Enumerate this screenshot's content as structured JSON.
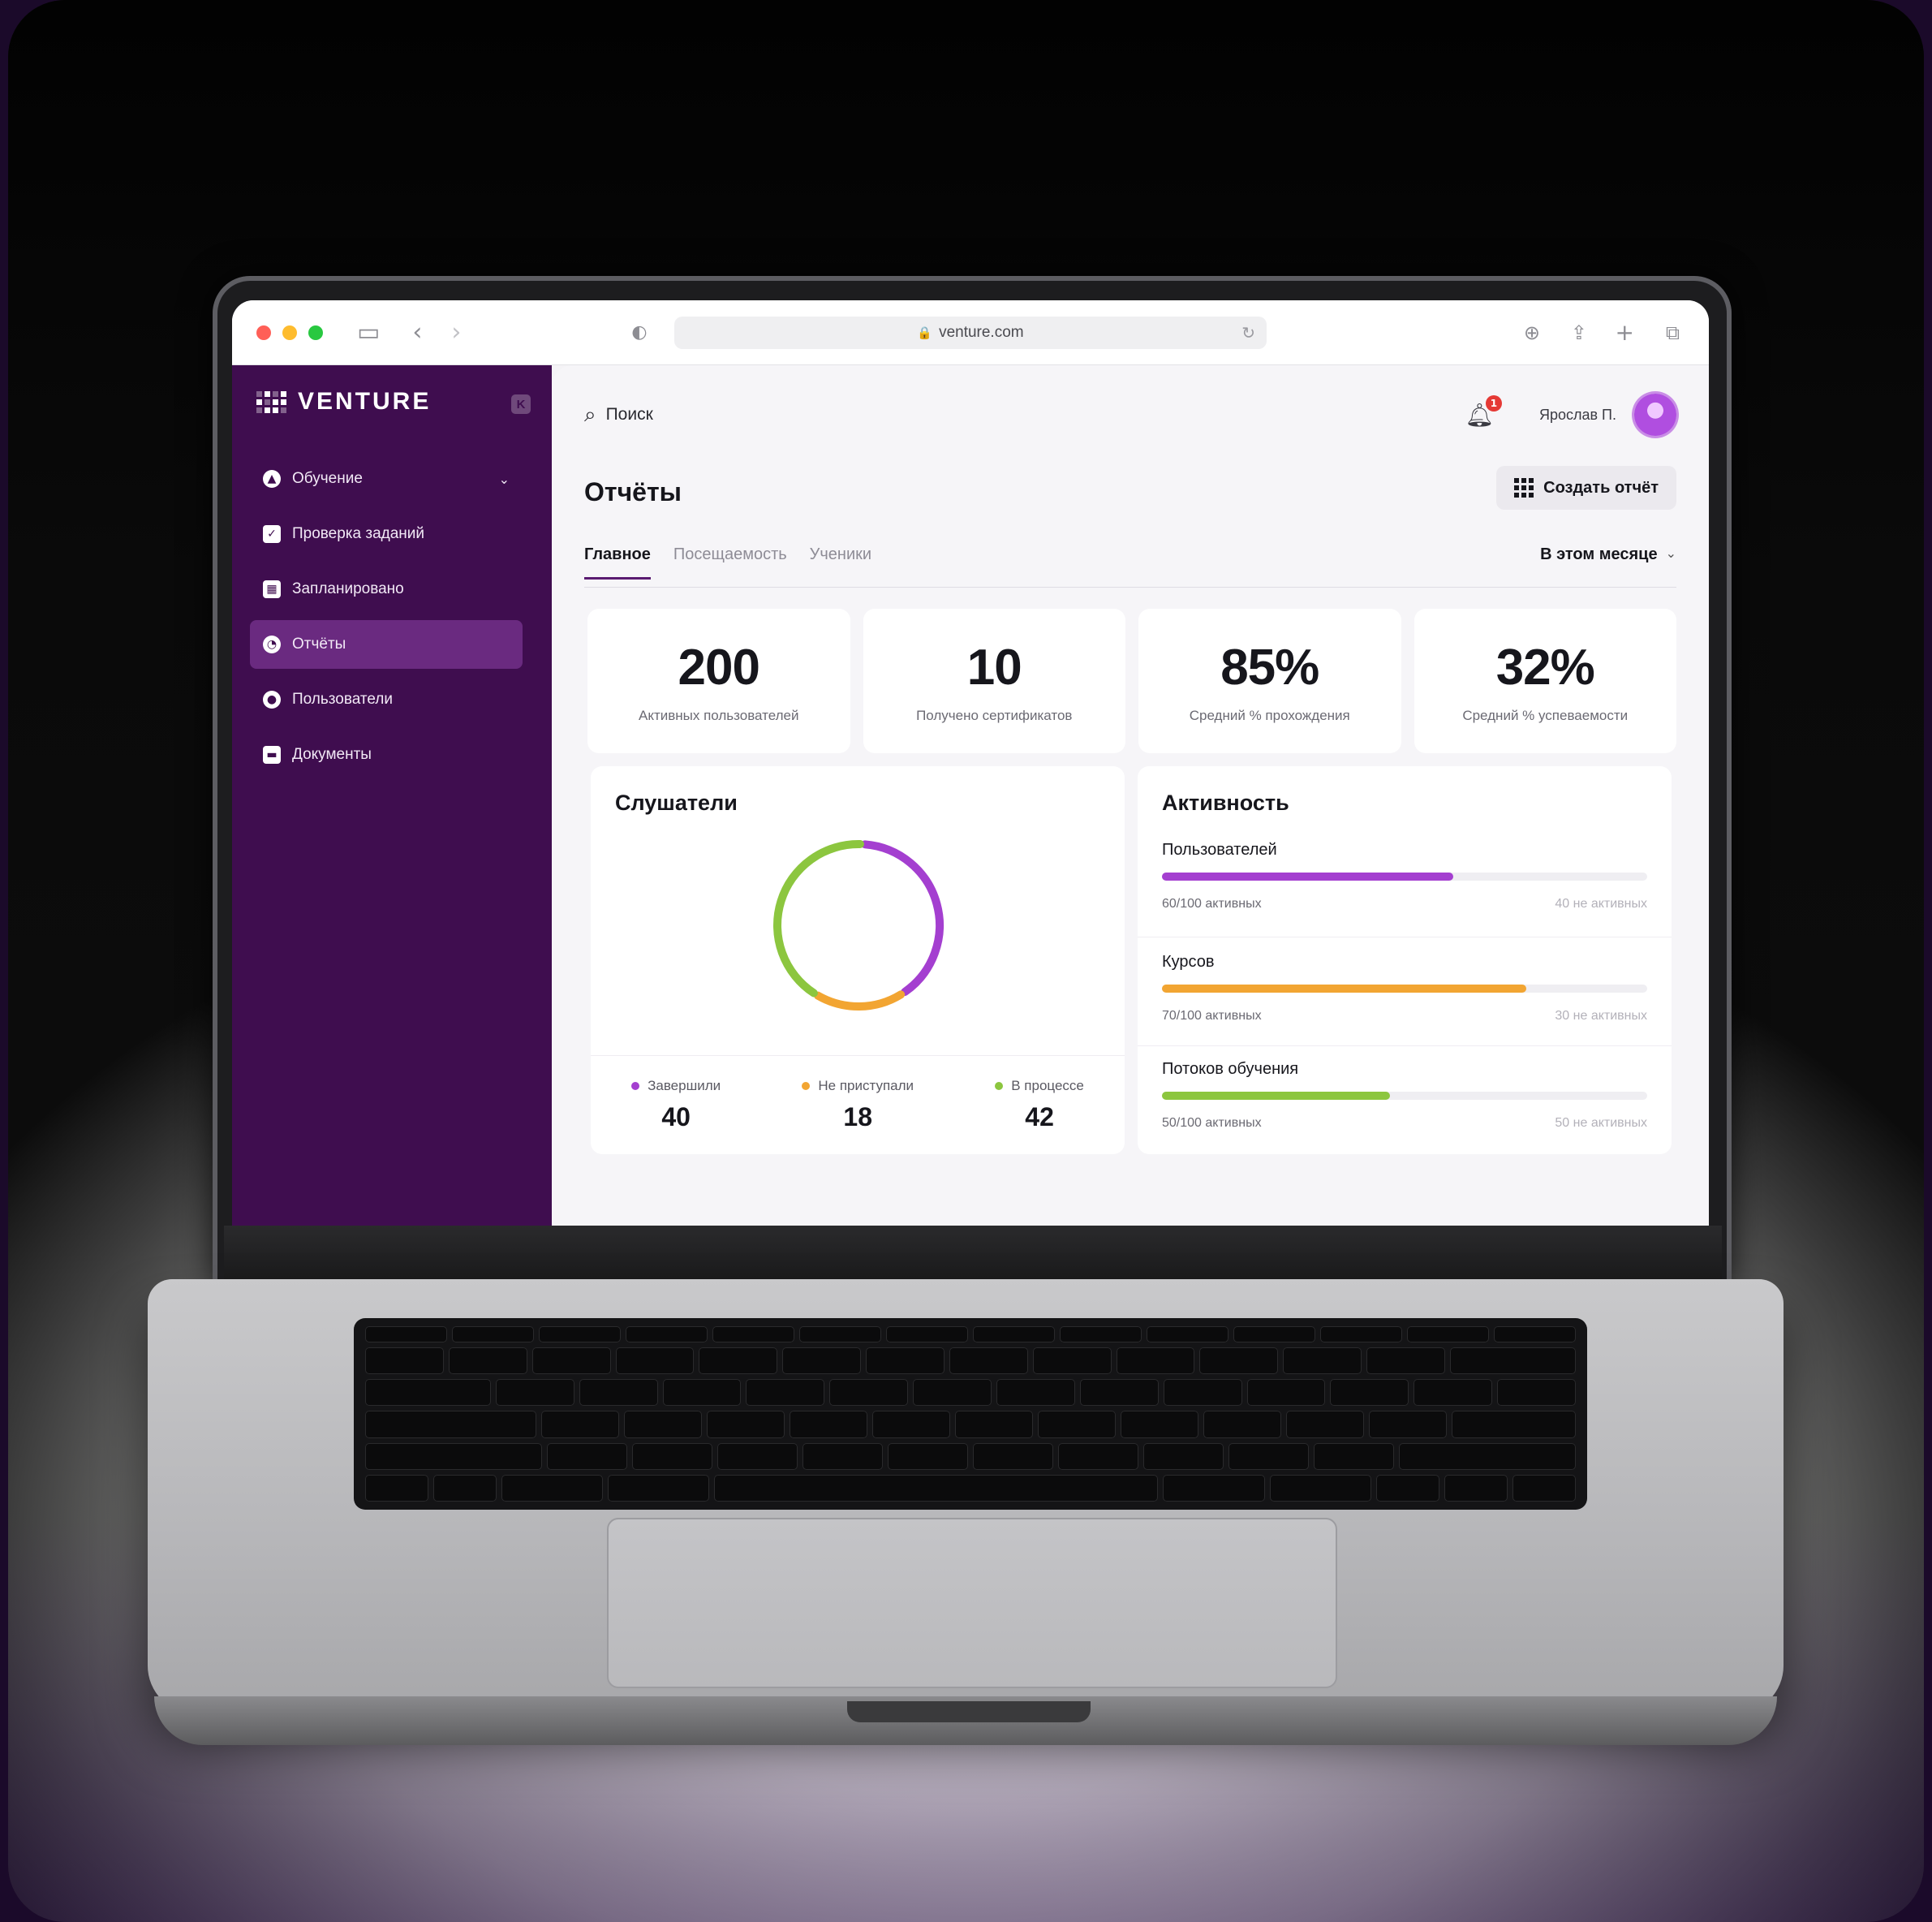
{
  "browser": {
    "url": "venture.com",
    "traffic_colors": [
      "#ff5f57",
      "#febc2e",
      "#28c840"
    ]
  },
  "sidebar": {
    "logo_text": "VENTURE",
    "collapse_icon": "k-square-icon",
    "items": [
      {
        "label": "Обучение",
        "icon": "graduation-cap-icon",
        "has_caret": true,
        "active": false
      },
      {
        "label": "Проверка заданий",
        "icon": "checkbox-icon",
        "active": false
      },
      {
        "label": "Запланировано",
        "icon": "calendar-icon",
        "active": false
      },
      {
        "label": "Отчёты",
        "icon": "pie-chart-icon",
        "active": true
      },
      {
        "label": "Пользователи",
        "icon": "user-icon",
        "active": false
      },
      {
        "label": "Документы",
        "icon": "folder-icon",
        "active": false
      }
    ],
    "bg_color": "#3f0d4f",
    "active_color": "#6a2a80"
  },
  "topbar": {
    "search_placeholder": "Поиск",
    "notification_count": "1",
    "user_name": "Ярослав П."
  },
  "page": {
    "title": "Отчёты",
    "create_button": "Создать отчёт",
    "tabs": [
      "Главное",
      "Посещаемость",
      "Ученики"
    ],
    "active_tab": 0,
    "period": "В этом месяце"
  },
  "stats": [
    {
      "value": "200",
      "label": "Активных пользователей"
    },
    {
      "value": "10",
      "label": "Получено сертификатов"
    },
    {
      "value": "85%",
      "label": "Средний % прохождения"
    },
    {
      "value": "32%",
      "label": "Средний % успеваемости"
    }
  ],
  "listeners": {
    "title": "Слушатели",
    "segments": [
      {
        "label": "Завершили",
        "value": "40",
        "color": "#a43fd0"
      },
      {
        "label": "Не приступали",
        "value": "18",
        "color": "#f2a532"
      },
      {
        "label": "В процессе",
        "value": "42",
        "color": "#8cc63f"
      }
    ]
  },
  "activity": {
    "title": "Активность",
    "metrics": [
      {
        "title": "Пользователей",
        "fraction": 0.6,
        "active_text": "60/100 активных",
        "inactive_text": "40 не активных",
        "color": "#a43fd0"
      },
      {
        "title": "Курсов",
        "fraction": 0.75,
        "active_text": "70/100 активных",
        "inactive_text": "30 не активных",
        "color": "#f2a532"
      },
      {
        "title": "Потоков обучения",
        "fraction": 0.47,
        "active_text": "50/100 активных",
        "inactive_text": "50 не активных",
        "color": "#8cc63f"
      }
    ]
  }
}
